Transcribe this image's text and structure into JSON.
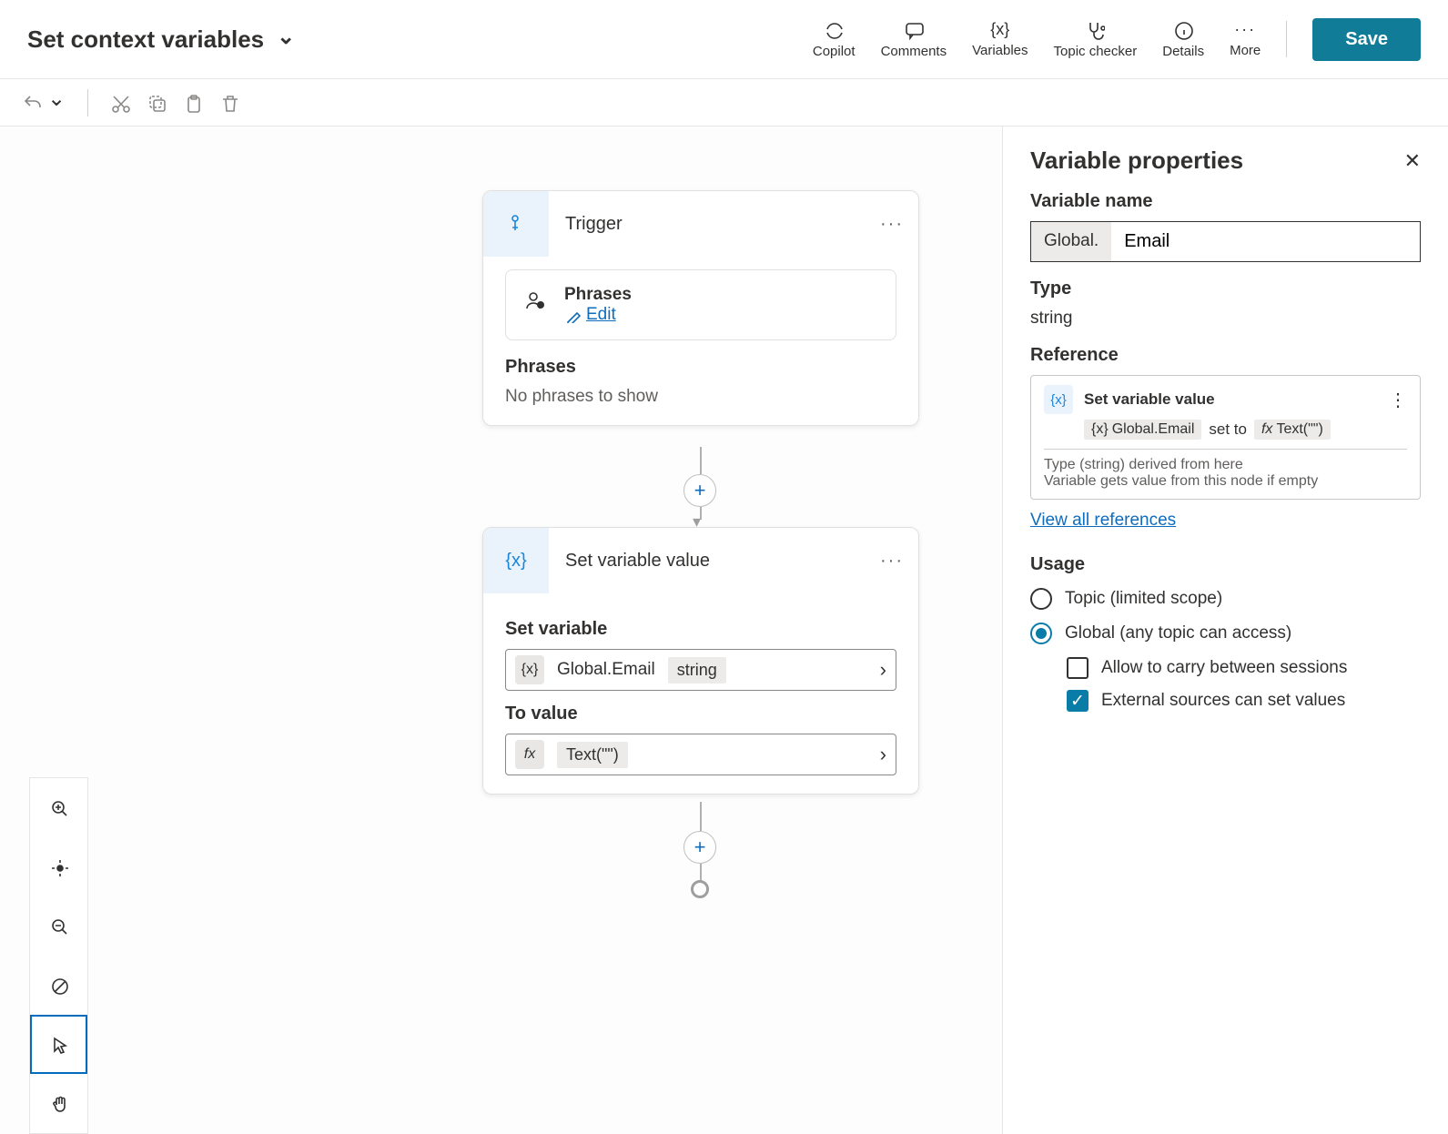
{
  "header": {
    "title": "Set context variables",
    "buttons": {
      "copilot": "Copilot",
      "comments": "Comments",
      "variables": "Variables",
      "topic_checker": "Topic checker",
      "details": "Details",
      "more": "More",
      "save": "Save"
    }
  },
  "trigger_node": {
    "title": "Trigger",
    "phrases_label": "Phrases",
    "edit_label": "Edit",
    "phrases_section": "Phrases",
    "empty_text": "No phrases to show"
  },
  "setvar_node": {
    "title": "Set variable value",
    "field_set": "Set variable",
    "var_name": "Global.Email",
    "var_type": "string",
    "field_to": "To value",
    "to_value": "Text(\"\")"
  },
  "panel": {
    "title": "Variable properties",
    "name_label": "Variable name",
    "name_prefix": "Global.",
    "name_value": "Email",
    "type_label": "Type",
    "type_value": "string",
    "ref_label": "Reference",
    "ref_title": "Set variable value",
    "ref_var": "Global.Email",
    "ref_setto": "set to",
    "ref_expr": "Text(\"\")",
    "ref_foot1": "Type (string) derived from here",
    "ref_foot2": "Variable gets value from this node if empty",
    "viewall": "View all references",
    "usage_label": "Usage",
    "usage_topic": "Topic (limited scope)",
    "usage_global": "Global (any topic can access)",
    "opt_carry": "Allow to carry between sessions",
    "opt_external": "External sources can set values"
  }
}
